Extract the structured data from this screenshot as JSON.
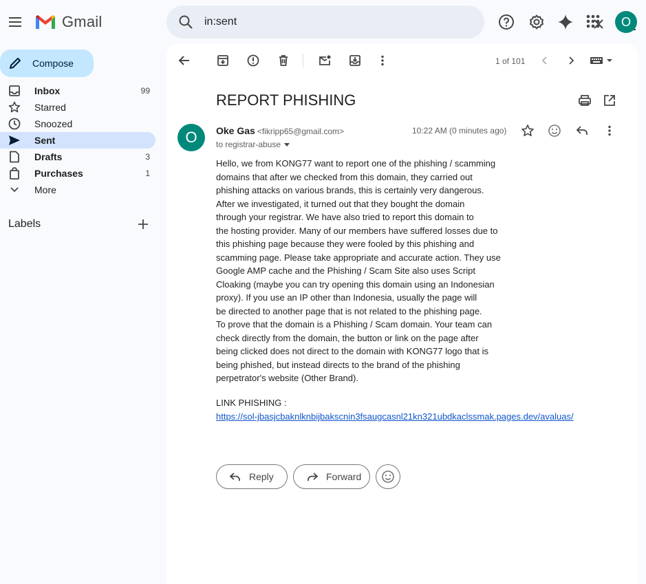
{
  "header": {
    "app_name": "Gmail",
    "search_value": "in:sent",
    "avatar_letter": "O"
  },
  "sidebar": {
    "compose_label": "Compose",
    "items": [
      {
        "label": "Inbox",
        "count": "99"
      },
      {
        "label": "Starred",
        "count": ""
      },
      {
        "label": "Snoozed",
        "count": ""
      },
      {
        "label": "Sent",
        "count": ""
      },
      {
        "label": "Drafts",
        "count": "3"
      },
      {
        "label": "Purchases",
        "count": "1"
      },
      {
        "label": "More",
        "count": ""
      }
    ],
    "labels_title": "Labels"
  },
  "toolbar": {
    "pager": "1 of 101"
  },
  "email": {
    "subject": "REPORT PHISHING",
    "sender_name": "Oke Gas",
    "sender_email": "<fikripp65@gmail.com>",
    "to": "to registrar-abuse",
    "time": "10:22 AM (0 minutes ago)",
    "avatar_letter": "O",
    "body": "Hello, we from KONG77 want to report one of the phishing / scamming\ndomains that after we checked from this domain, they carried out\nphishing attacks on various brands, this is certainly very dangerous.\nAfter we investigated, it turned out that they bought the domain\nthrough your registrar. We have also tried to report this domain to\nthe hosting provider. Many of our members have suffered losses due to\nthis phishing page because they were fooled by this phishing and\nscamming page. Please take appropriate and accurate action. They use\nGoogle AMP cache and the Phishing / Scam Site also uses Script\nCloaking (maybe you can try opening this domain using an Indonesian\nproxy). If you use an IP other than Indonesia, usually the page will\nbe directed to another page that is not related to the phishing page.\nTo prove that the domain is a Phishing / Scam domain. Your team can\ncheck directly from the domain, the button or link on the page after\nbeing clicked does not direct to the domain with KONG77 logo that is\nbeing phished, but instead directs to the brand of the phishing\nperpetrator's website (Other Brand).",
    "link_label": "LINK PHISHING :",
    "link_url": "https://sol-jbasjcbaknlknbijbakscnin3fsaugcasnl21kn321ubdkaclssmak.pages.dev/avaluas/"
  },
  "actions": {
    "reply_label": "Reply",
    "forward_label": "Forward"
  },
  "colors": {
    "accent_blue": "#c2e7ff",
    "active_nav": "#d3e3fd",
    "avatar": "#00897b",
    "link": "#1155cc"
  }
}
